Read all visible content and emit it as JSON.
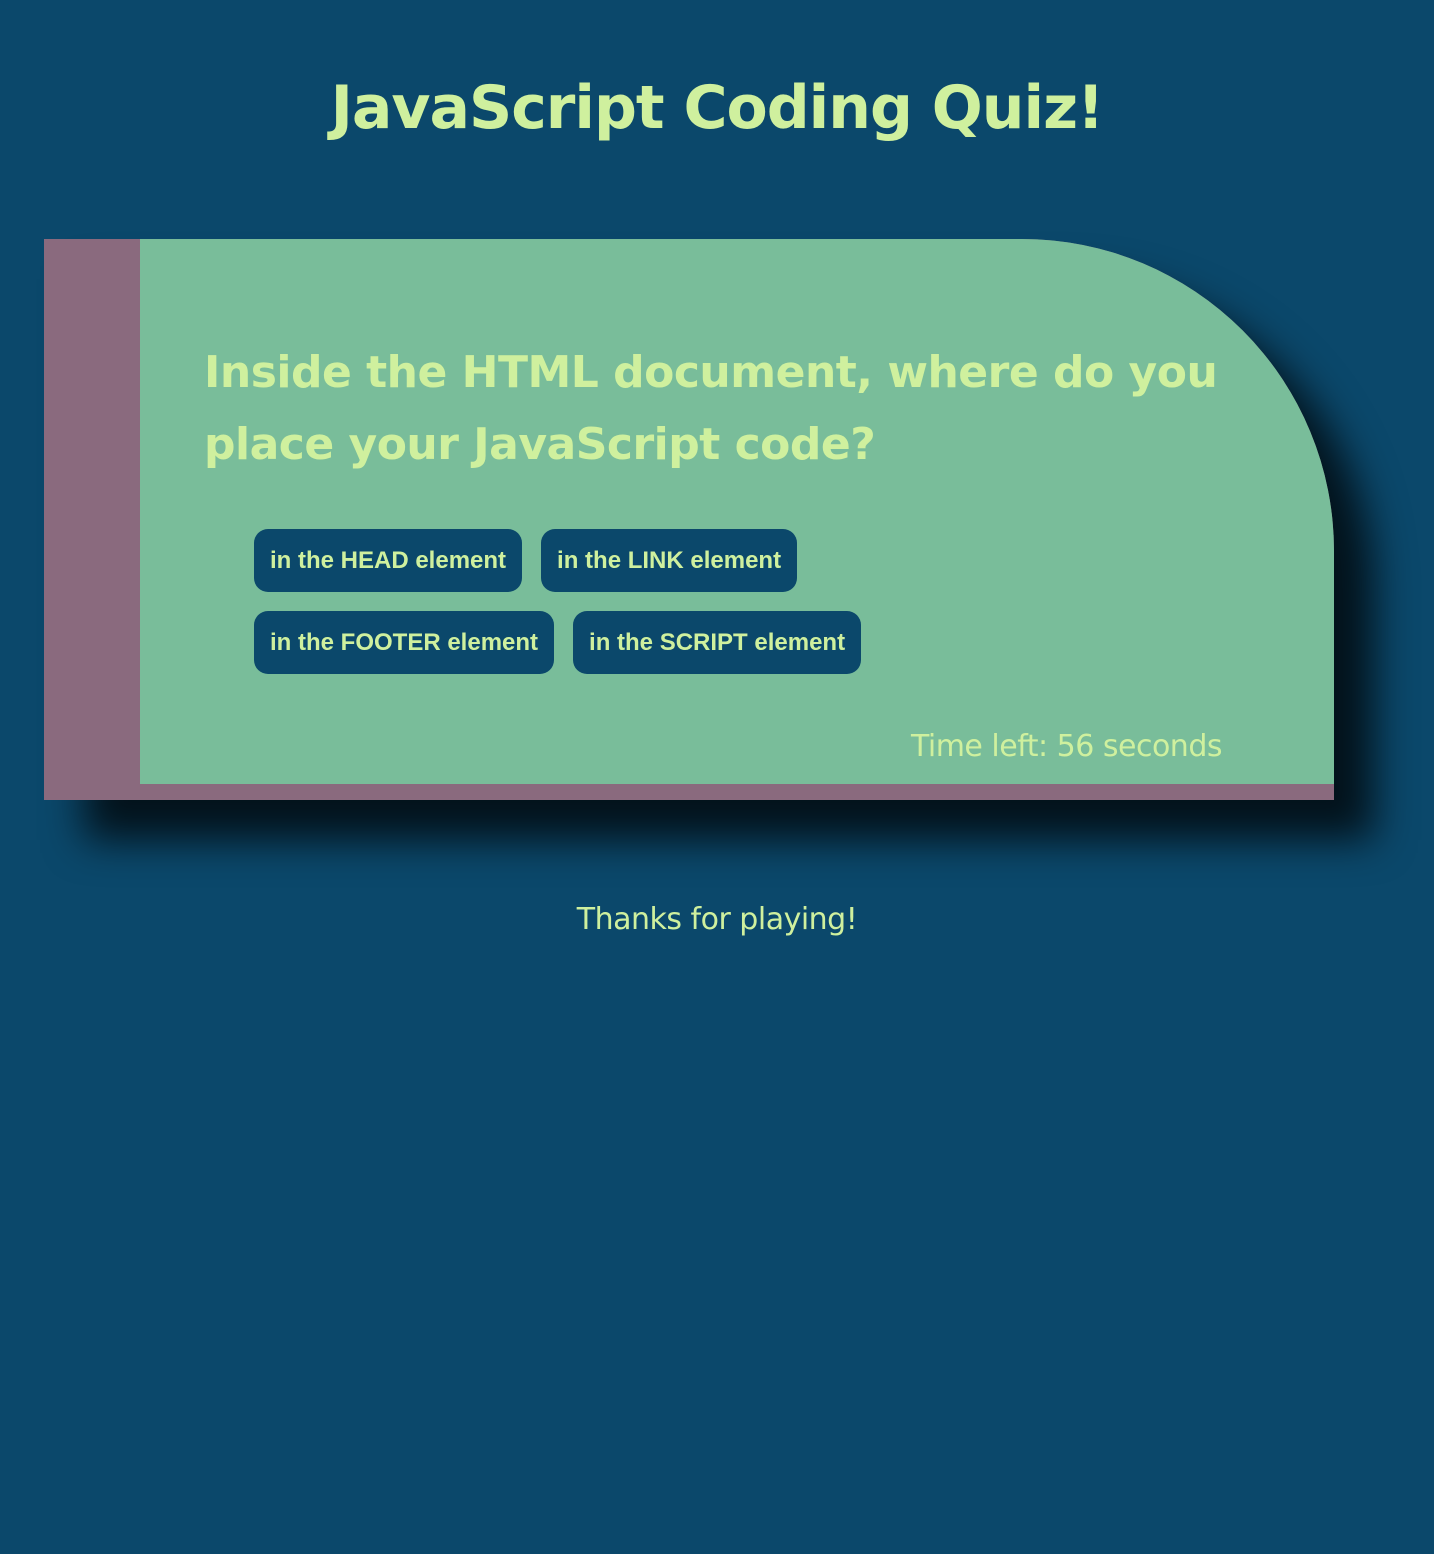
{
  "page": {
    "title": "JavaScript Coding Quiz!",
    "footer_message": "Thanks for playing!"
  },
  "quiz": {
    "question": "Inside the HTML document, where do you place your JavaScript code?",
    "answers": [
      "in the HEAD element",
      "in the LINK element",
      "in the FOOTER element",
      "in the SCRIPT element"
    ],
    "timer_text": "Time left: 56 seconds"
  },
  "colors": {
    "background": "#0b486b",
    "card_accent": "#8a6a7e",
    "card_body": "#79bd9a",
    "text": "#cff09e",
    "button": "#0b486b"
  }
}
